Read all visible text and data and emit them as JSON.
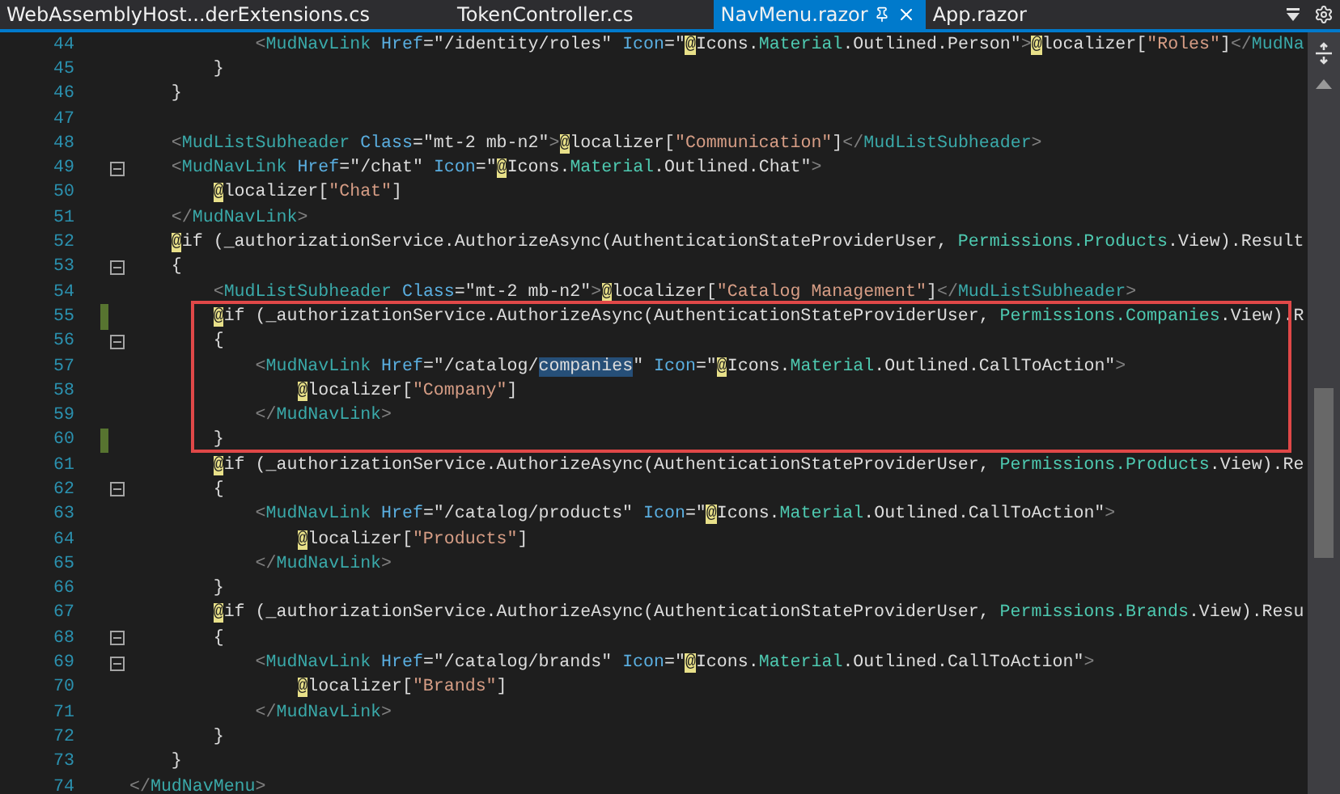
{
  "tabs": [
    {
      "label": "WebAssemblyHost...derExtensions.cs",
      "selected": false
    },
    {
      "label": "TokenController.cs",
      "selected": false
    },
    {
      "label": "NavMenu.razor",
      "selected": true
    },
    {
      "label": "App.razor",
      "selected": false
    }
  ],
  "editor": {
    "lines": [
      {
        "number": "44",
        "collapsible": false,
        "changed": false,
        "tokens": [
          {
            "kind": "punct",
            "text": "            <"
          },
          {
            "kind": "tag",
            "text": "MudNavLink"
          },
          {
            "kind": "attr",
            "text": " Href"
          },
          {
            "kind": "plain",
            "text": "=\"/identity/roles\""
          },
          {
            "kind": "attr",
            "text": " Icon"
          },
          {
            "kind": "plain",
            "text": "=\""
          },
          {
            "kind": "at",
            "text": "@"
          },
          {
            "kind": "plain",
            "text": "Icons."
          },
          {
            "kind": "type",
            "text": "Material"
          },
          {
            "kind": "plain",
            "text": ".Outlined.Person\""
          },
          {
            "kind": "punct",
            "text": ">"
          },
          {
            "kind": "at",
            "text": "@"
          },
          {
            "kind": "plain",
            "text": "localizer["
          },
          {
            "kind": "string",
            "text": "\"Roles\""
          },
          {
            "kind": "plain",
            "text": "]"
          },
          {
            "kind": "punct",
            "text": "</"
          },
          {
            "kind": "tag",
            "text": "MudNa"
          }
        ]
      },
      {
        "number": "45",
        "collapsible": false,
        "changed": false,
        "tokens": [
          {
            "kind": "plain",
            "text": "        }"
          }
        ]
      },
      {
        "number": "46",
        "collapsible": false,
        "changed": false,
        "tokens": [
          {
            "kind": "plain",
            "text": "    }"
          }
        ]
      },
      {
        "number": "47",
        "collapsible": false,
        "changed": false
      },
      {
        "number": "48",
        "collapsible": false,
        "changed": false,
        "tokens": [
          {
            "kind": "punct",
            "text": "    <"
          },
          {
            "kind": "tag",
            "text": "MudListSubheader"
          },
          {
            "kind": "attr",
            "text": " Class"
          },
          {
            "kind": "plain",
            "text": "=\"mt-2 mb-n2\""
          },
          {
            "kind": "punct",
            "text": ">"
          },
          {
            "kind": "at",
            "text": "@"
          },
          {
            "kind": "plain",
            "text": "localizer["
          },
          {
            "kind": "string",
            "text": "\"Communication\""
          },
          {
            "kind": "plain",
            "text": "]"
          },
          {
            "kind": "punct",
            "text": "</"
          },
          {
            "kind": "tag",
            "text": "MudListSubheader"
          },
          {
            "kind": "punct",
            "text": ">"
          }
        ]
      },
      {
        "number": "49",
        "collapsible": true,
        "changed": false,
        "tokens": [
          {
            "kind": "punct",
            "text": "    <"
          },
          {
            "kind": "tag",
            "text": "MudNavLink"
          },
          {
            "kind": "attr",
            "text": " Href"
          },
          {
            "kind": "plain",
            "text": "=\"/chat\""
          },
          {
            "kind": "attr",
            "text": " Icon"
          },
          {
            "kind": "plain",
            "text": "=\""
          },
          {
            "kind": "at",
            "text": "@"
          },
          {
            "kind": "plain",
            "text": "Icons."
          },
          {
            "kind": "type",
            "text": "Material"
          },
          {
            "kind": "plain",
            "text": ".Outlined.Chat\""
          },
          {
            "kind": "punct",
            "text": ">"
          }
        ]
      },
      {
        "number": "50",
        "collapsible": false,
        "changed": false,
        "tokens": [
          {
            "kind": "at",
            "text": "        @"
          },
          {
            "kind": "plain",
            "text": "localizer["
          },
          {
            "kind": "string",
            "text": "\"Chat\""
          },
          {
            "kind": "plain",
            "text": "]"
          }
        ]
      },
      {
        "number": "51",
        "collapsible": false,
        "changed": false,
        "tokens": [
          {
            "kind": "punct",
            "text": "    </"
          },
          {
            "kind": "tag",
            "text": "MudNavLink"
          },
          {
            "kind": "punct",
            "text": ">"
          }
        ]
      },
      {
        "number": "52",
        "collapsible": false,
        "changed": false,
        "tokens": [
          {
            "kind": "at",
            "text": "    @"
          },
          {
            "kind": "plain",
            "text": "if (_authorizationService.AuthorizeAsync(AuthenticationStateProviderUser, "
          },
          {
            "kind": "type",
            "text": "Permissions"
          },
          {
            "kind": "type",
            "text": ".Products"
          },
          {
            "kind": "plain",
            "text": ".View).Result"
          }
        ]
      },
      {
        "number": "53",
        "collapsible": true,
        "changed": false,
        "tokens": [
          {
            "kind": "plain",
            "text": "    {"
          }
        ]
      },
      {
        "number": "54",
        "collapsible": false,
        "changed": false,
        "tokens": [
          {
            "kind": "punct",
            "text": "        <"
          },
          {
            "kind": "tag",
            "text": "MudListSubheader"
          },
          {
            "kind": "attr",
            "text": " Class"
          },
          {
            "kind": "plain",
            "text": "=\"mt-2 mb-n2\""
          },
          {
            "kind": "punct",
            "text": ">"
          },
          {
            "kind": "at",
            "text": "@"
          },
          {
            "kind": "plain",
            "text": "localizer["
          },
          {
            "kind": "string",
            "text": "\"Catalog Management\""
          },
          {
            "kind": "plain",
            "text": "]"
          },
          {
            "kind": "punct",
            "text": "</"
          },
          {
            "kind": "tag",
            "text": "MudListSubheader"
          },
          {
            "kind": "punct",
            "text": ">"
          }
        ]
      },
      {
        "number": "55",
        "collapsible": false,
        "changed": true,
        "tokens": [
          {
            "kind": "at",
            "text": "        @"
          },
          {
            "kind": "plain",
            "text": "if (_authorizationService.AuthorizeAsync(AuthenticationStateProviderUser, "
          },
          {
            "kind": "type",
            "text": "Permissions"
          },
          {
            "kind": "type",
            "text": ".Companies"
          },
          {
            "kind": "plain",
            "text": ".View).R"
          }
        ]
      },
      {
        "number": "56",
        "collapsible": true,
        "changed": false,
        "tokens": [
          {
            "kind": "plain",
            "text": "        {"
          }
        ]
      },
      {
        "number": "57",
        "collapsible": false,
        "changed": false,
        "tokens": [
          {
            "kind": "punct",
            "text": "            <"
          },
          {
            "kind": "tag",
            "text": "MudNavLink"
          },
          {
            "kind": "attr",
            "text": " Href"
          },
          {
            "kind": "plain",
            "text": "=\"/catalog/"
          },
          {
            "kind": "selected",
            "text": "companies"
          },
          {
            "kind": "plain",
            "text": "\""
          },
          {
            "kind": "attr",
            "text": " Icon"
          },
          {
            "kind": "plain",
            "text": "=\""
          },
          {
            "kind": "at",
            "text": "@"
          },
          {
            "kind": "plain",
            "text": "Icons."
          },
          {
            "kind": "type",
            "text": "Material"
          },
          {
            "kind": "plain",
            "text": ".Outlined.CallToAction\""
          },
          {
            "kind": "punct",
            "text": ">"
          }
        ]
      },
      {
        "number": "58",
        "collapsible": false,
        "changed": false,
        "tokens": [
          {
            "kind": "at",
            "text": "                @"
          },
          {
            "kind": "plain",
            "text": "localizer["
          },
          {
            "kind": "string",
            "text": "\"Company\""
          },
          {
            "kind": "plain",
            "text": "]"
          }
        ]
      },
      {
        "number": "59",
        "collapsible": false,
        "changed": false,
        "tokens": [
          {
            "kind": "punct",
            "text": "            </"
          },
          {
            "kind": "tag",
            "text": "MudNavLink"
          },
          {
            "kind": "punct",
            "text": ">"
          }
        ]
      },
      {
        "number": "60",
        "collapsible": false,
        "changed": true,
        "tokens": [
          {
            "kind": "plain",
            "text": "        }"
          }
        ]
      },
      {
        "number": "61",
        "collapsible": false,
        "changed": false,
        "tokens": [
          {
            "kind": "at",
            "text": "        @"
          },
          {
            "kind": "plain",
            "text": "if (_authorizationService.AuthorizeAsync(AuthenticationStateProviderUser, "
          },
          {
            "kind": "type",
            "text": "Permissions"
          },
          {
            "kind": "type",
            "text": ".Products"
          },
          {
            "kind": "plain",
            "text": ".View).Re"
          }
        ]
      },
      {
        "number": "62",
        "collapsible": true,
        "changed": false,
        "tokens": [
          {
            "kind": "plain",
            "text": "        {"
          }
        ]
      },
      {
        "number": "63",
        "collapsible": false,
        "changed": false,
        "tokens": [
          {
            "kind": "punct",
            "text": "            <"
          },
          {
            "kind": "tag",
            "text": "MudNavLink"
          },
          {
            "kind": "attr",
            "text": " Href"
          },
          {
            "kind": "plain",
            "text": "=\"/catalog/products\""
          },
          {
            "kind": "attr",
            "text": " Icon"
          },
          {
            "kind": "plain",
            "text": "=\""
          },
          {
            "kind": "at",
            "text": "@"
          },
          {
            "kind": "plain",
            "text": "Icons."
          },
          {
            "kind": "type",
            "text": "Material"
          },
          {
            "kind": "plain",
            "text": ".Outlined.CallToAction\""
          },
          {
            "kind": "punct",
            "text": ">"
          }
        ]
      },
      {
        "number": "64",
        "collapsible": false,
        "changed": false,
        "tokens": [
          {
            "kind": "at",
            "text": "                @"
          },
          {
            "kind": "plain",
            "text": "localizer["
          },
          {
            "kind": "string",
            "text": "\"Products\""
          },
          {
            "kind": "plain",
            "text": "]"
          }
        ]
      },
      {
        "number": "65",
        "collapsible": false,
        "changed": false,
        "tokens": [
          {
            "kind": "punct",
            "text": "            </"
          },
          {
            "kind": "tag",
            "text": "MudNavLink"
          },
          {
            "kind": "punct",
            "text": ">"
          }
        ]
      },
      {
        "number": "66",
        "collapsible": false,
        "changed": false,
        "tokens": [
          {
            "kind": "plain",
            "text": "        }"
          }
        ]
      },
      {
        "number": "67",
        "collapsible": false,
        "changed": false,
        "tokens": [
          {
            "kind": "at",
            "text": "        @"
          },
          {
            "kind": "plain",
            "text": "if (_authorizationService.AuthorizeAsync(AuthenticationStateProviderUser, "
          },
          {
            "kind": "type",
            "text": "Permissions"
          },
          {
            "kind": "type",
            "text": ".Brands"
          },
          {
            "kind": "plain",
            "text": ".View).Resu"
          }
        ]
      },
      {
        "number": "68",
        "collapsible": true,
        "changed": false,
        "tokens": [
          {
            "kind": "plain",
            "text": "        {"
          }
        ]
      },
      {
        "number": "69",
        "collapsible": true,
        "changed": false,
        "tokens": [
          {
            "kind": "punct",
            "text": "            <"
          },
          {
            "kind": "tag",
            "text": "MudNavLink"
          },
          {
            "kind": "attr",
            "text": " Href"
          },
          {
            "kind": "plain",
            "text": "=\"/catalog/brands\""
          },
          {
            "kind": "attr",
            "text": " Icon"
          },
          {
            "kind": "plain",
            "text": "=\""
          },
          {
            "kind": "at",
            "text": "@"
          },
          {
            "kind": "plain",
            "text": "Icons."
          },
          {
            "kind": "type",
            "text": "Material"
          },
          {
            "kind": "plain",
            "text": ".Outlined.CallToAction\""
          },
          {
            "kind": "punct",
            "text": ">"
          }
        ]
      },
      {
        "number": "70",
        "collapsible": false,
        "changed": false,
        "tokens": [
          {
            "kind": "at",
            "text": "                @"
          },
          {
            "kind": "plain",
            "text": "localizer["
          },
          {
            "kind": "string",
            "text": "\"Brands\""
          },
          {
            "kind": "plain",
            "text": "]"
          }
        ]
      },
      {
        "number": "71",
        "collapsible": false,
        "changed": false,
        "tokens": [
          {
            "kind": "punct",
            "text": "            </"
          },
          {
            "kind": "tag",
            "text": "MudNavLink"
          },
          {
            "kind": "punct",
            "text": ">"
          }
        ]
      },
      {
        "number": "72",
        "collapsible": false,
        "changed": false,
        "tokens": [
          {
            "kind": "plain",
            "text": "        }"
          }
        ]
      },
      {
        "number": "73",
        "collapsible": false,
        "changed": false,
        "tokens": [
          {
            "kind": "plain",
            "text": "    }"
          }
        ]
      },
      {
        "number": "74",
        "collapsible": false,
        "changed": false,
        "tokens": [
          {
            "kind": "punct",
            "text": "</"
          },
          {
            "kind": "tag",
            "text": "MudNavMenu"
          },
          {
            "kind": "punct",
            "text": ">"
          }
        ]
      }
    ]
  }
}
